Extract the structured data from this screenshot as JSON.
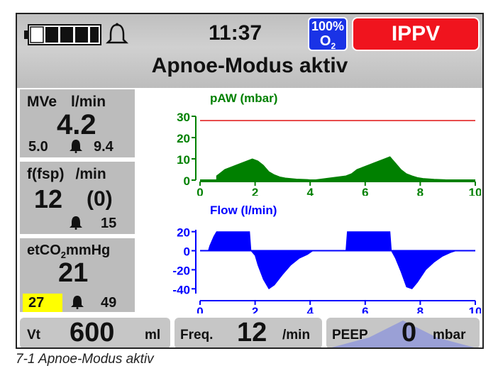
{
  "header": {
    "time": "11:37",
    "oxygen_percent": "100%",
    "oxygen_gas": "O",
    "oxygen_sub": "2",
    "mode": "IPPV",
    "status": "Apnoe-Modus aktiv",
    "battery_level": 0.2
  },
  "colors": {
    "pressure": "#008000",
    "flow": "#0000ff",
    "limit_line": "#e01010",
    "mode_bg": "#f0141e",
    "o2_bg": "#1a33e6",
    "alarm_highlight": "#ffff00"
  },
  "panels": {
    "mve": {
      "label": "MVe",
      "unit": "l/min",
      "value": "4.2",
      "low": "5.0",
      "high": "9.4"
    },
    "freq": {
      "label": "f(fsp)",
      "unit": "/min",
      "value": "12",
      "spont": "(0)",
      "high": "15"
    },
    "etco2": {
      "label": "etCO",
      "label_sub": "2",
      "unit": "mmHg",
      "value": "21",
      "low": "27",
      "high": "49"
    }
  },
  "chart_data": [
    {
      "type": "area",
      "title": "pAW (mbar)",
      "xlim": [
        0,
        10
      ],
      "ylim": [
        0,
        30
      ],
      "x_ticks": [
        "0",
        "2",
        "4",
        "6",
        "8",
        "10"
      ],
      "y_ticks": [
        "0",
        "10",
        "20",
        "30"
      ],
      "threshold": 28,
      "series": [
        {
          "x": [
            0.6,
            0.7,
            0.9,
            1.1,
            1.3,
            1.5,
            1.7,
            1.9,
            2.1,
            2.3,
            2.5,
            2.7,
            2.9,
            3.1,
            3.5,
            3.9,
            4.1,
            5.3,
            5.5,
            5.7,
            5.9,
            6.1,
            6.3,
            6.5,
            6.7,
            6.9,
            7.1,
            7.3,
            7.5,
            7.7,
            7.9,
            8.1,
            8.5,
            8.9,
            9.0
          ],
          "y": [
            2,
            3,
            5,
            6,
            7,
            8,
            9,
            10,
            9,
            7,
            4,
            2.5,
            1.5,
            1,
            0.5,
            0.3,
            0,
            2,
            3,
            5,
            6,
            7,
            8,
            9,
            10,
            11,
            8,
            5,
            3,
            2,
            1.2,
            0.8,
            0.4,
            0.2,
            0
          ]
        }
      ]
    },
    {
      "type": "area",
      "title": "Flow (l/min)",
      "xlim": [
        0,
        10
      ],
      "ylim": [
        -45,
        22
      ],
      "x_ticks": [
        "0",
        "2",
        "4",
        "6",
        "8",
        "10"
      ],
      "y_ticks": [
        "20",
        "0",
        "-20",
        "-40"
      ],
      "series": [
        {
          "x": [
            0.3,
            0.35,
            0.5,
            0.6,
            1.8,
            1.85,
            2.0,
            2.1,
            2.3,
            2.5,
            2.7,
            3.0,
            3.3,
            3.6,
            3.9,
            4.1,
            5.3,
            5.35,
            6.9,
            6.95,
            7.1,
            7.3,
            7.5,
            7.7,
            7.9,
            8.2,
            8.5,
            8.8,
            9.1,
            9.3
          ],
          "y": [
            0,
            5,
            15,
            20,
            20,
            0,
            -5,
            -15,
            -30,
            -40,
            -36,
            -25,
            -15,
            -8,
            -4,
            0,
            0,
            20,
            20,
            0,
            -8,
            -22,
            -38,
            -40,
            -33,
            -20,
            -12,
            -6,
            -2,
            0
          ]
        }
      ]
    }
  ],
  "settings": {
    "vt": {
      "label": "Vt",
      "value": "600",
      "unit": "ml"
    },
    "freq": {
      "label": "Freq.",
      "value": "12",
      "unit": "/min"
    },
    "peep": {
      "label": "PEEP",
      "value": "0",
      "unit": "mbar"
    }
  },
  "caption": "7-1  Apnoe-Modus aktiv"
}
